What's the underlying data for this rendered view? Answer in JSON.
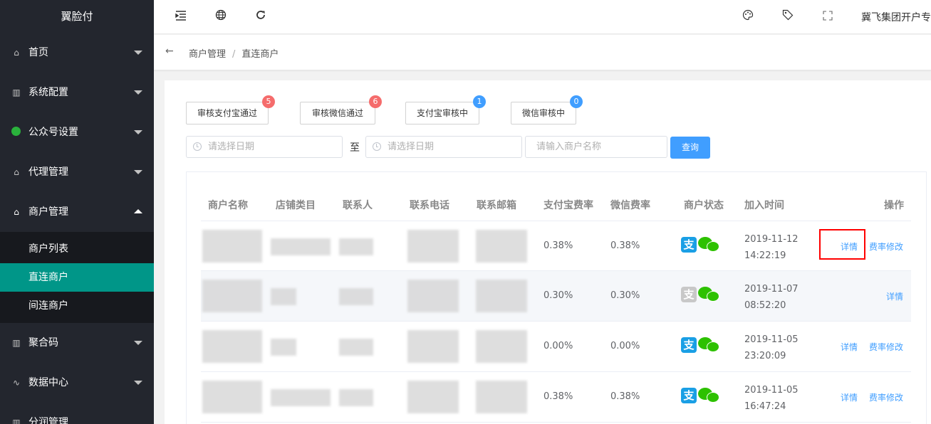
{
  "app": {
    "title": "翼脸付"
  },
  "sidebar": {
    "items": [
      {
        "label": "首页",
        "icon": "home-icon"
      },
      {
        "label": "系统配置",
        "icon": "chart-icon"
      },
      {
        "label": "公众号设置",
        "icon": "wechat-icon"
      },
      {
        "label": "代理管理",
        "icon": "home-icon"
      },
      {
        "label": "商户管理",
        "icon": "home-icon",
        "expanded": true
      },
      {
        "label": "聚合码",
        "icon": "chart-icon"
      },
      {
        "label": "数据中心",
        "icon": "pulse-icon"
      },
      {
        "label": "分润管理",
        "icon": "chart-icon"
      }
    ],
    "submenu": [
      "商户列表",
      "直连商户",
      "间连商户"
    ],
    "active_sub": "直连商户",
    "accent_color": "#009688"
  },
  "header": {
    "icons": [
      "menu-fold-icon",
      "globe-icon",
      "refresh-icon",
      "palette-icon",
      "tag-icon",
      "fullscreen-icon"
    ],
    "user": "冀飞集团开户专"
  },
  "breadcrumb": {
    "items": [
      "商户管理",
      "直连商户"
    ],
    "separator": "/"
  },
  "filters": {
    "buttons": [
      {
        "label": "审核支付宝通过",
        "count": "5",
        "color": "#f56c6c"
      },
      {
        "label": "审核微信通过",
        "count": "6",
        "color": "#f56c6c"
      },
      {
        "label": "支付宝审核中",
        "count": "1",
        "color": "#409eff"
      },
      {
        "label": "微信审核中",
        "count": "0",
        "color": "#409eff"
      }
    ],
    "date_placeholder": "请选择日期",
    "to_label": "至",
    "search_placeholder": "请输入商户名称",
    "query_label": "查询"
  },
  "table": {
    "headers": [
      "商户名称",
      "店铺类目",
      "联系人",
      "联系电话",
      "联系邮箱",
      "支付宝费率",
      "微信费率",
      "商户状态",
      "加入时间",
      "操作"
    ],
    "rows": [
      {
        "alipay_rate": "0.38%",
        "wechat_rate": "0.38%",
        "alipay_status": "active",
        "date": "2019-11-12",
        "time": "14:22:19",
        "actions": [
          "详情",
          "费率修改"
        ]
      },
      {
        "alipay_rate": "0.30%",
        "wechat_rate": "0.30%",
        "alipay_status": "inactive",
        "date": "2019-11-07",
        "time": "08:52:20",
        "actions": [
          "详情"
        ]
      },
      {
        "alipay_rate": "0.00%",
        "wechat_rate": "0.00%",
        "alipay_status": "active",
        "date": "2019-11-05",
        "time": "23:20:09",
        "actions": [
          "详情",
          "费率修改"
        ]
      },
      {
        "alipay_rate": "0.38%",
        "wechat_rate": "0.38%",
        "alipay_status": "active",
        "date": "2019-11-05",
        "time": "16:47:24",
        "actions": [
          "详情",
          "费率修改"
        ]
      }
    ]
  },
  "colors": {
    "link": "#409eff",
    "primary_button": "#409eff",
    "highlight": "#ff0000"
  }
}
